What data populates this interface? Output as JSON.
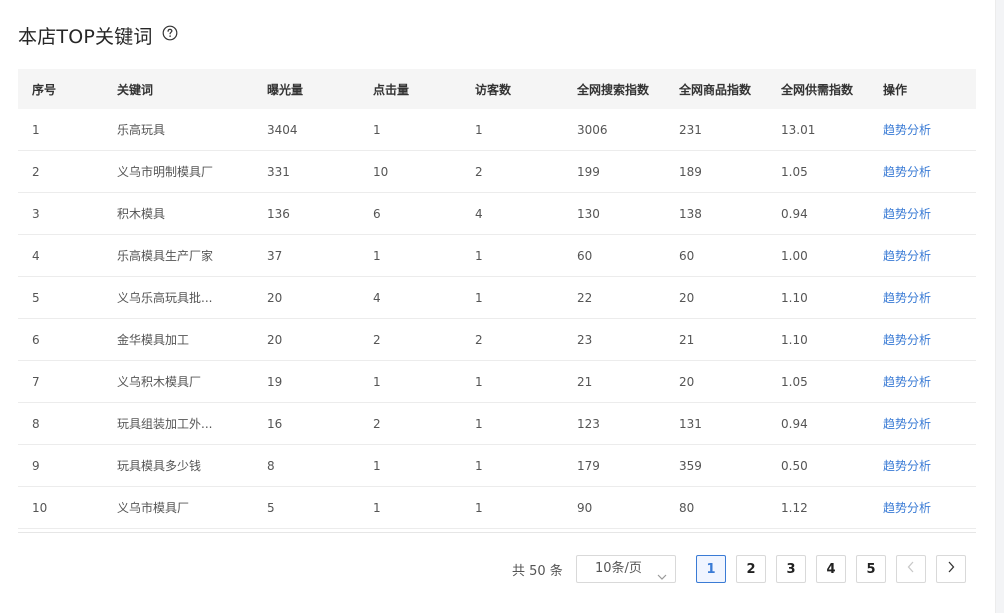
{
  "header": {
    "title": "本店TOP关键词",
    "help_icon": "question-circle-icon"
  },
  "table": {
    "columns": [
      "序号",
      "关键词",
      "曝光量",
      "点击量",
      "访客数",
      "全网搜索指数",
      "全网商品指数",
      "全网供需指数",
      "操作"
    ],
    "rows": [
      [
        "1",
        "乐高玩具",
        "3404",
        "1",
        "1",
        "3006",
        "231",
        "13.01",
        "趋势分析"
      ],
      [
        "2",
        "义乌市明制模具厂",
        "331",
        "10",
        "2",
        "199",
        "189",
        "1.05",
        "趋势分析"
      ],
      [
        "3",
        "积木模具",
        "136",
        "6",
        "4",
        "130",
        "138",
        "0.94",
        "趋势分析"
      ],
      [
        "4",
        "乐高模具生产厂家",
        "37",
        "1",
        "1",
        "60",
        "60",
        "1.00",
        "趋势分析"
      ],
      [
        "5",
        "义乌乐高玩具批...",
        "20",
        "4",
        "1",
        "22",
        "20",
        "1.10",
        "趋势分析"
      ],
      [
        "6",
        "金华模具加工",
        "20",
        "2",
        "2",
        "23",
        "21",
        "1.10",
        "趋势分析"
      ],
      [
        "7",
        "义乌积木模具厂",
        "19",
        "1",
        "1",
        "21",
        "20",
        "1.05",
        "趋势分析"
      ],
      [
        "8",
        "玩具组装加工外...",
        "16",
        "2",
        "1",
        "123",
        "131",
        "0.94",
        "趋势分析"
      ],
      [
        "9",
        "玩具模具多少钱",
        "8",
        "1",
        "1",
        "179",
        "359",
        "0.50",
        "趋势分析"
      ],
      [
        "10",
        "义乌市模具厂",
        "5",
        "1",
        "1",
        "90",
        "80",
        "1.12",
        "趋势分析"
      ]
    ]
  },
  "pagination": {
    "total_text": "共 50 条",
    "page_size": "10条/页",
    "pages": [
      "1",
      "2",
      "3",
      "4",
      "5"
    ],
    "current": "1",
    "prev_icon": "chevron-left-icon",
    "next_icon": "chevron-right-icon"
  },
  "colors": {
    "accent": "#3a7bd5",
    "header_bg": "#f5f5f5",
    "border": "#ececec"
  }
}
